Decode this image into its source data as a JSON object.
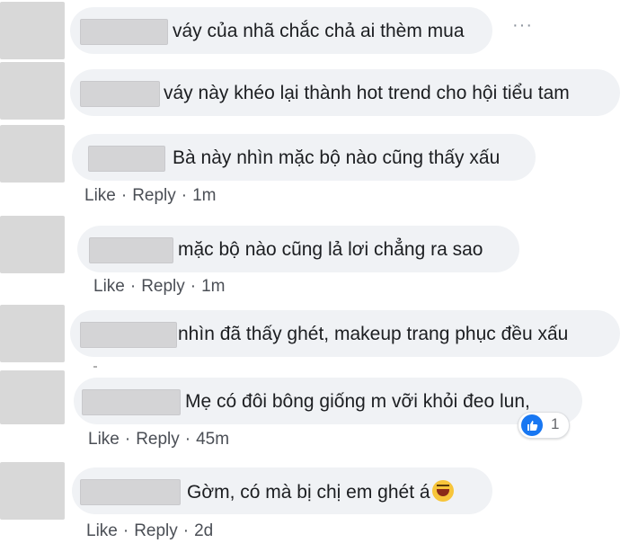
{
  "comments": [
    {
      "text": "váy của nhã chắc chả ai thèm mua",
      "more": "···"
    },
    {
      "text": "váy này khéo lại thành hot trend cho hội tiểu tam"
    },
    {
      "text": "Bà này nhìn mặc bộ nào cũng thấy xấu",
      "like": "Like",
      "reply": "Reply",
      "time": "1m"
    },
    {
      "text": "mặc bộ nào cũng lả lơi chẳng ra sao",
      "like": "Like",
      "reply": "Reply",
      "time": "1m"
    },
    {
      "text": "nhìn đã thấy ghét, makeup trang phục đều xấu"
    },
    {
      "text": "Mẹ có đôi bông giống m vỡi khỏi đeo lun,",
      "like": "Like",
      "reply": "Reply",
      "time": "45m",
      "reaction_count": "1",
      "reaction_icon": "thumbs-up-icon"
    },
    {
      "text": "Gờm, có mà bị chị em ghét á",
      "emoji": "laughing-emoji-icon",
      "like": "Like",
      "reply": "Reply",
      "time": "2d"
    }
  ],
  "actions_separator": "·"
}
